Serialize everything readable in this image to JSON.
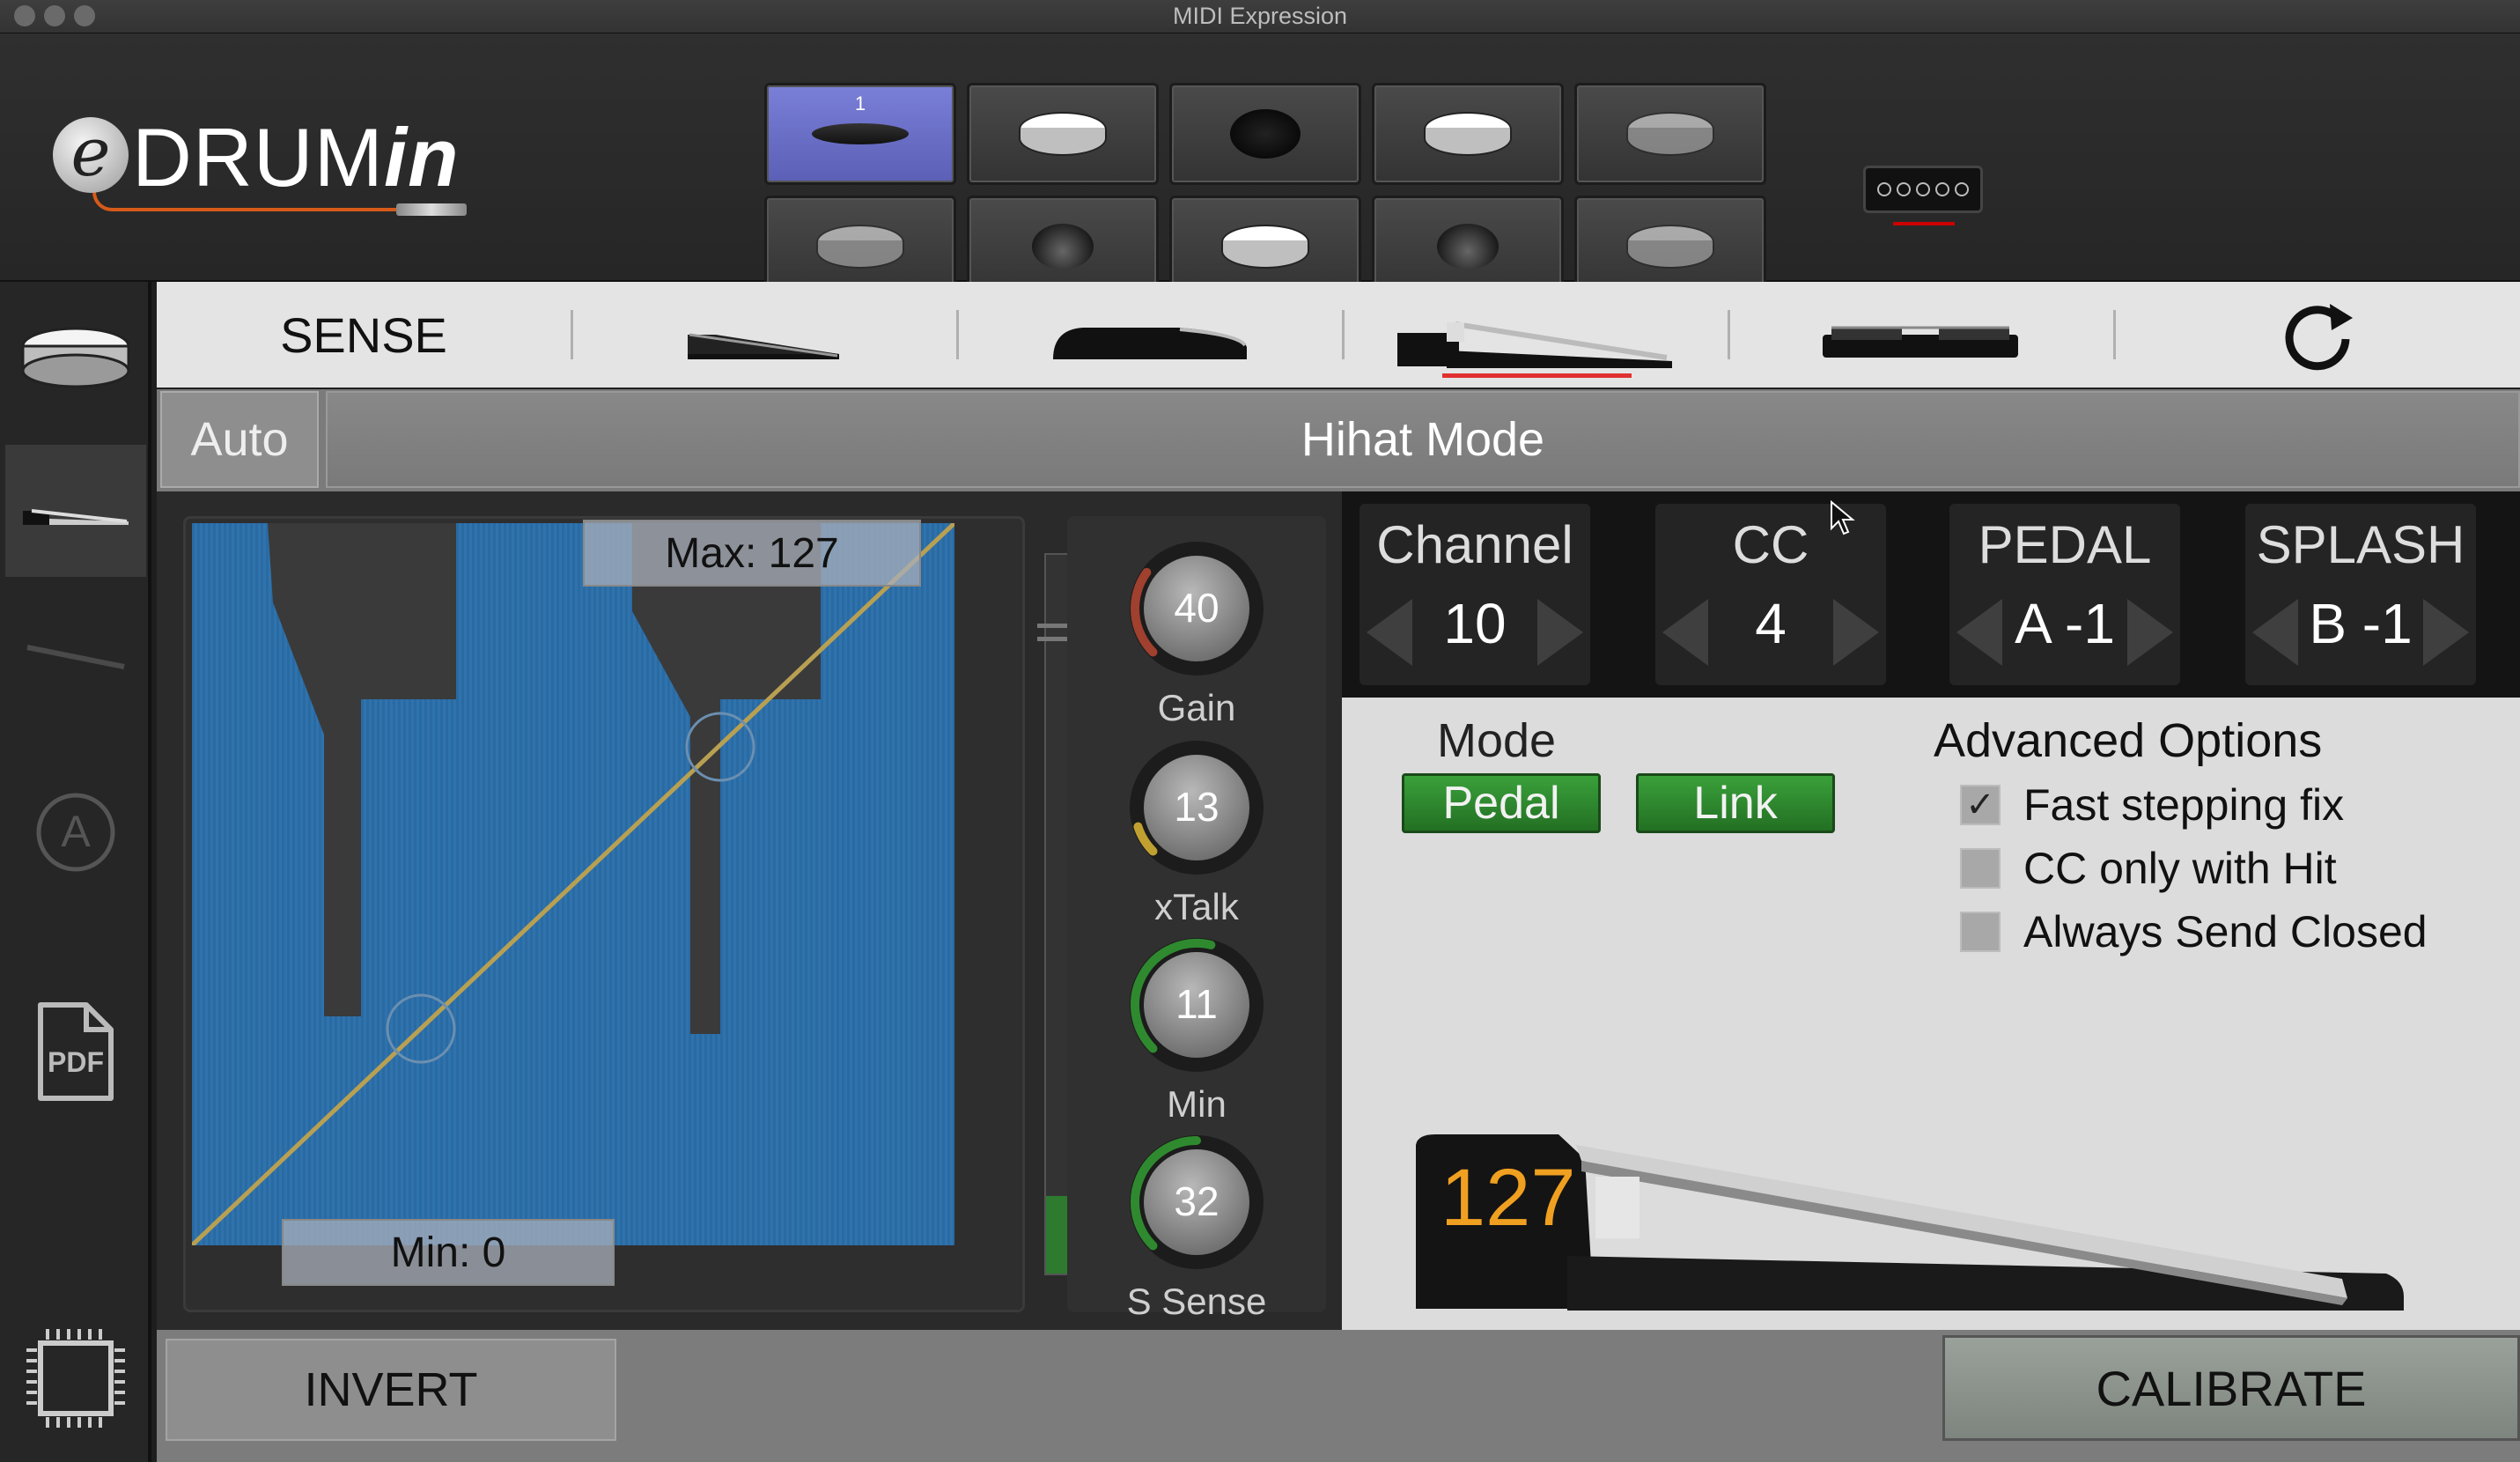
{
  "window": {
    "title": "MIDI Expression"
  },
  "header": {
    "logo_text": "eDRUMin",
    "pads": [
      {
        "kind": "hihat",
        "label": "1",
        "active": true
      },
      {
        "kind": "snare"
      },
      {
        "kind": "black-pad"
      },
      {
        "kind": "snare"
      },
      {
        "kind": "snare-dim"
      },
      {
        "kind": "snare-dim"
      },
      {
        "kind": "cymbal"
      },
      {
        "kind": "snare"
      },
      {
        "kind": "cymbal"
      },
      {
        "kind": "snare-dim"
      }
    ]
  },
  "sidebar": {
    "items": [
      {
        "icon": "snare-drum-icon"
      },
      {
        "icon": "pedal-icon"
      },
      {
        "icon": "ride-cymbal-icon"
      },
      {
        "icon": "auto-a-icon"
      },
      {
        "icon": "pdf-icon",
        "label": "PDF"
      },
      {
        "icon": "chip-icon"
      }
    ]
  },
  "tabs": {
    "sense_label": "SENSE",
    "items": [
      "expression-pedal-icon",
      "sustain-pedal-icon",
      "hihat-pedal-icon",
      "flat-pedal-icon",
      "reset-icon"
    ],
    "active_index": 2
  },
  "mode_row": {
    "auto_label": "Auto",
    "mode_label": "Hihat Mode"
  },
  "curve": {
    "max_label": "Max: 127",
    "min_label": "Min: 0",
    "max_value": 127,
    "min_value": 0,
    "slider_level": 0.12
  },
  "knobs": [
    {
      "value": "40",
      "label": "Gain",
      "arc_color": "#a0402e",
      "fraction": 0.3
    },
    {
      "value": "13",
      "label": "xTalk",
      "arc_color": "#c0a030",
      "fraction": 0.1
    },
    {
      "value": "11",
      "label": "Min",
      "arc_color": "#2f8a2f",
      "fraction": 0.55
    },
    {
      "value": "32",
      "label": "S Sense",
      "arc_color": "#2f8a2f",
      "fraction": 0.5
    }
  ],
  "params": [
    {
      "label": "Channel",
      "value": "10"
    },
    {
      "label": "CC",
      "value": "4"
    },
    {
      "label": "PEDAL",
      "value": "A -1"
    },
    {
      "label": "SPLASH",
      "value": "B -1"
    }
  ],
  "options": {
    "mode_title": "Mode",
    "pedal_button": "Pedal",
    "link_button": "Link",
    "advanced_title": "Advanced Options",
    "checkboxes": [
      {
        "label": "Fast stepping fix",
        "checked": true,
        "mark": "✓"
      },
      {
        "label": "CC only with Hit",
        "checked": false,
        "mark": ""
      },
      {
        "label": "Always Send Closed",
        "checked": false,
        "mark": ""
      }
    ],
    "pedal_value": "127"
  },
  "bottom": {
    "invert_label": "INVERT",
    "calibrate_label": "CALIBRATE"
  },
  "colors": {
    "curve_fill": "#2f73ad",
    "curve_line": "#b8a052",
    "active_pad": "#6a6fd0",
    "green_button": "#2f8a2f",
    "pedal_value": "#f0a020",
    "underline": "#e03030"
  }
}
